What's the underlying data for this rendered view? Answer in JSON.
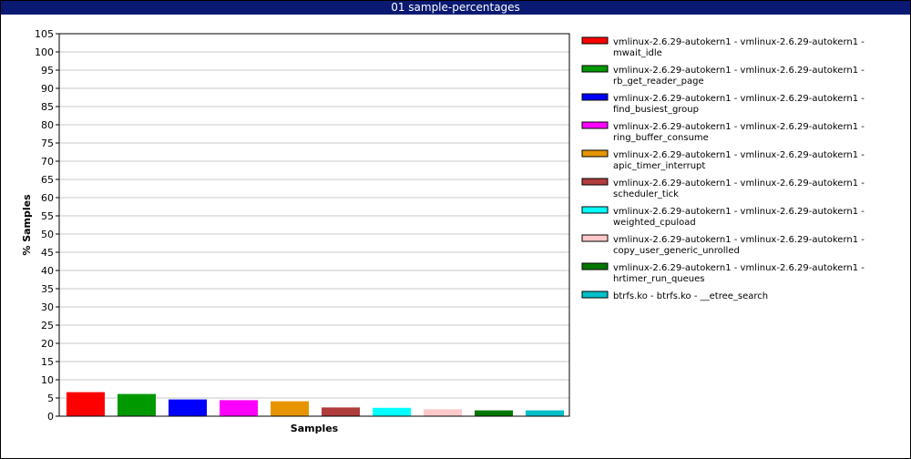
{
  "window": {
    "title": "01 sample-percentages"
  },
  "chart_data": {
    "type": "bar",
    "title": "01 sample-percentages",
    "xlabel": "Samples",
    "ylabel": "% Samples",
    "ylim": [
      0,
      105
    ],
    "ytick_step": 5,
    "grid": true,
    "legend_position": "right",
    "categories": [
      "vmlinux-2.6.29-autokern1 - vmlinux-2.6.29-autokern1 - mwait_idle",
      "vmlinux-2.6.29-autokern1 - vmlinux-2.6.29-autokern1 - rb_get_reader_page",
      "vmlinux-2.6.29-autokern1 - vmlinux-2.6.29-autokern1 - find_busiest_group",
      "vmlinux-2.6.29-autokern1 - vmlinux-2.6.29-autokern1 - ring_buffer_consume",
      "vmlinux-2.6.29-autokern1 - vmlinux-2.6.29-autokern1 - apic_timer_interrupt",
      "vmlinux-2.6.29-autokern1 - vmlinux-2.6.29-autokern1 - scheduler_tick",
      "vmlinux-2.6.29-autokern1 - vmlinux-2.6.29-autokern1 - weighted_cpuload",
      "vmlinux-2.6.29-autokern1 - vmlinux-2.6.29-autokern1 - copy_user_generic_unrolled",
      "vmlinux-2.6.29-autokern1 - vmlinux-2.6.29-autokern1 - hrtimer_run_queues",
      "btrfs.ko - btrfs.ko - __etree_search"
    ],
    "legend_lines": [
      [
        "vmlinux-2.6.29-autokern1 - vmlinux-2.6.29-autokern1 -",
        "mwait_idle"
      ],
      [
        "vmlinux-2.6.29-autokern1 - vmlinux-2.6.29-autokern1 -",
        "rb_get_reader_page"
      ],
      [
        "vmlinux-2.6.29-autokern1 - vmlinux-2.6.29-autokern1 -",
        "find_busiest_group"
      ],
      [
        "vmlinux-2.6.29-autokern1 - vmlinux-2.6.29-autokern1 -",
        "ring_buffer_consume"
      ],
      [
        "vmlinux-2.6.29-autokern1 - vmlinux-2.6.29-autokern1 -",
        "apic_timer_interrupt"
      ],
      [
        "vmlinux-2.6.29-autokern1 - vmlinux-2.6.29-autokern1 -",
        "scheduler_tick"
      ],
      [
        "vmlinux-2.6.29-autokern1 - vmlinux-2.6.29-autokern1 -",
        "weighted_cpuload"
      ],
      [
        "vmlinux-2.6.29-autokern1 - vmlinux-2.6.29-autokern1 -",
        "copy_user_generic_unrolled"
      ],
      [
        "vmlinux-2.6.29-autokern1 - vmlinux-2.6.29-autokern1 -",
        "hrtimer_run_queues"
      ],
      [
        "btrfs.ko - btrfs.ko - __etree_search"
      ]
    ],
    "values": [
      6.6,
      6.1,
      4.6,
      4.4,
      4.1,
      2.4,
      2.3,
      1.9,
      1.6,
      1.6
    ],
    "colors": [
      "#ff0000",
      "#009900",
      "#0000ff",
      "#ff00ff",
      "#e69500",
      "#b03c3c",
      "#00ffff",
      "#ffc8c8",
      "#007700",
      "#00c0c8"
    ]
  }
}
